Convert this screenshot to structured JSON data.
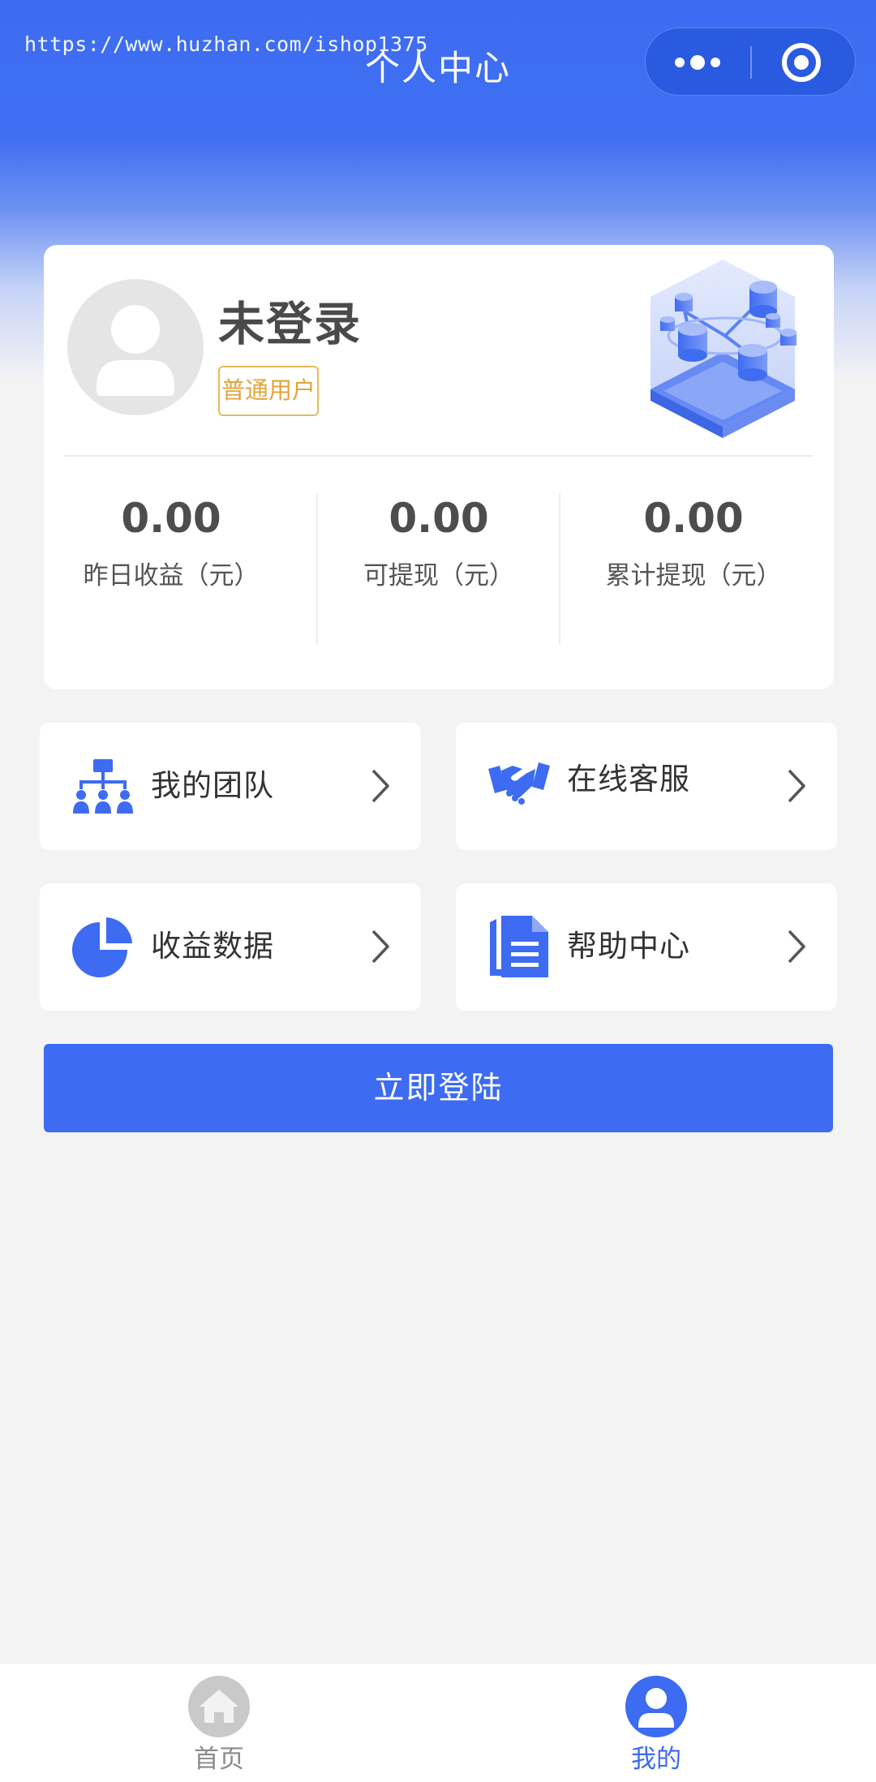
{
  "watermark": "https://www.huzhan.com/ishop1375",
  "header": {
    "title": "个人中心",
    "capsule": {
      "more_icon": "more-dots-icon",
      "close_icon": "target-icon"
    }
  },
  "profile": {
    "name": "未登录",
    "tag": "普通用户",
    "avatar_icon": "user-avatar-icon",
    "decoration_icon": "isometric-data-icon"
  },
  "stats": [
    {
      "value": "0.00",
      "label": "昨日收益（元）"
    },
    {
      "value": "0.00",
      "label": "可提现（元）"
    },
    {
      "value": "0.00",
      "label": "累计提现（元）"
    }
  ],
  "menu": [
    {
      "label": "我的团队",
      "icon": "team-tree-icon"
    },
    {
      "label": "在线客服",
      "icon": "handshake-icon"
    },
    {
      "label": "收益数据",
      "icon": "pie-chart-icon"
    },
    {
      "label": "帮助中心",
      "icon": "document-icon"
    }
  ],
  "login_button": "立即登陆",
  "tabbar": [
    {
      "label": "首页",
      "icon": "home-icon",
      "active": false
    },
    {
      "label": "我的",
      "icon": "user-icon",
      "active": true
    }
  ],
  "colors": {
    "primary": "#3d6bf1",
    "tag": "#e0a53a",
    "tab_inactive": "#8a8a8a",
    "background": "#f3f3f4"
  }
}
